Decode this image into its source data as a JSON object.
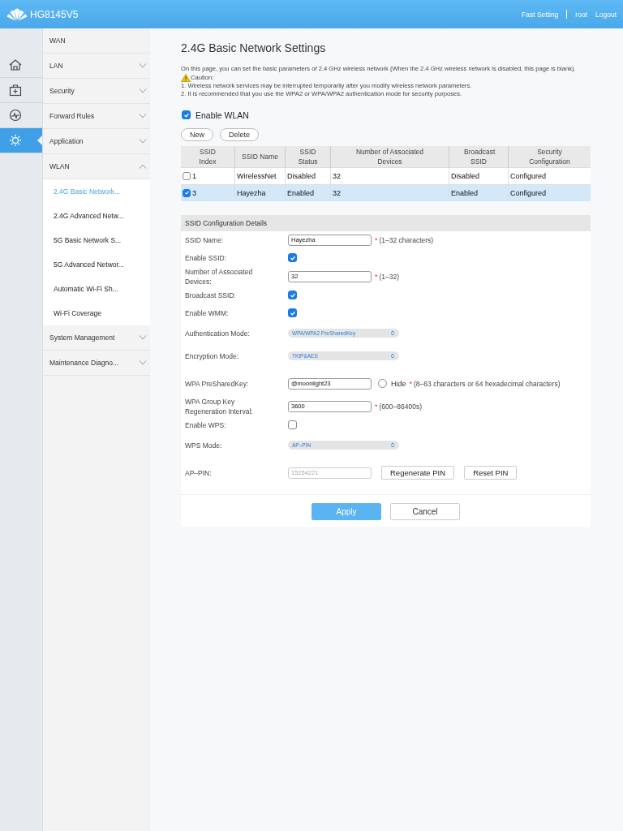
{
  "header": {
    "logo_text": "HG8145V5",
    "links": [
      "Fast Setting",
      "root",
      "Logout"
    ]
  },
  "rail": [
    {
      "selected": false
    },
    {
      "selected": false
    },
    {
      "selected": false
    },
    {
      "selected": true
    }
  ],
  "nav": [
    {
      "label": "WAN",
      "kind": "link"
    },
    {
      "label": "LAN",
      "kind": "group",
      "expanded": false
    },
    {
      "label": "Security",
      "kind": "group",
      "expanded": false
    },
    {
      "label": "Forward Rules",
      "kind": "group",
      "expanded": false
    },
    {
      "label": "Application",
      "kind": "group",
      "expanded": false
    },
    {
      "label": "WLAN",
      "kind": "group",
      "expanded": true,
      "children": [
        {
          "label": "2.4G Basic Network...",
          "selected": true
        },
        {
          "label": "2.4G Advanced Netw...",
          "selected": false
        },
        {
          "label": "5G Basic Network S...",
          "selected": false
        },
        {
          "label": "5G Advanced Networ...",
          "selected": false
        },
        {
          "label": "Automatic Wi-Fi Sh...",
          "selected": false
        },
        {
          "label": "Wi-Fi Coverage",
          "selected": false
        }
      ]
    },
    {
      "label": "System Management",
      "kind": "group",
      "expanded": false
    },
    {
      "label": "Maintenance Diagno...",
      "kind": "group",
      "expanded": false
    }
  ],
  "page": {
    "title": "2.4G Basic Network Settings",
    "intro": "On this page, you can set the basic parameters of 2.4 GHz wireless network (When the 2.4 GHz wireless network is disabled, this page is blank).",
    "caution_label": "Caution:",
    "notes": [
      "1. Wireless network services may be interrupted temporarily after you modify wireless network parameters.",
      "2. It is recommended that you use the WPA2 or WPA/WPA2 authentication mode for security purposes."
    ],
    "enable_wlan": {
      "label": "Enable WLAN",
      "checked": true
    },
    "buttons": [
      "New",
      "Delete"
    ],
    "table": {
      "columns": [
        "SSID Index",
        "SSID Name",
        "SSID Status",
        "Number of Associated Devices",
        "Broadcast SSID",
        "Security Configuration"
      ],
      "rows": [
        {
          "selected": false,
          "cells": [
            "1",
            "WirelessNet",
            "Disabled",
            "32",
            "Disabled",
            "Configured"
          ]
        },
        {
          "selected": true,
          "cells": [
            "3",
            "Hayezha",
            "Enabled",
            "32",
            "Enabled",
            "Configured"
          ]
        }
      ]
    },
    "details": {
      "heading": "SSID Configuration Details",
      "fields": [
        {
          "kind": "text",
          "label": "SSID Name:",
          "value": "Hayezha",
          "required_mark": "*",
          "hint": "(1–32 characters)"
        },
        {
          "kind": "checkbox",
          "label": "Enable SSID:",
          "checked": true
        },
        {
          "kind": "text",
          "label": "Number of Associated Devices:",
          "value": "32",
          "required_mark": "*",
          "hint": "(1–32)"
        },
        {
          "kind": "checkbox",
          "label": "Broadcast SSID:",
          "checked": true
        },
        {
          "kind": "checkbox",
          "label": "Enable WMM:",
          "checked": true
        },
        {
          "kind": "select",
          "label": "Authentication Mode:",
          "value": "WPA/WPA2 PreSharedKey"
        },
        {
          "kind": "select",
          "label": "Encryption Mode:",
          "value": "TKIP&AES"
        },
        {
          "kind": "key",
          "label": "WPA PreSharedKey:",
          "value": "@moonlight23",
          "hide_label": "Hide",
          "hide_checked": false,
          "required_mark": "*",
          "hint": "(8–63 characters or 64 hexadecimal characters)"
        },
        {
          "kind": "text",
          "label": "WPA Group Key Regeneration Interval:",
          "value": "3600",
          "required_mark": "*",
          "hint": "(600–86400s)"
        },
        {
          "kind": "checkbox",
          "label": "Enable WPS:",
          "checked": false
        },
        {
          "kind": "select",
          "label": "WPS Mode:",
          "value": "AP–PIN"
        },
        {
          "kind": "pin",
          "label": "AP–PIN:",
          "value": "15254221",
          "disabled": true,
          "buttons": [
            "Regenerate PIN",
            "Reset PIN"
          ]
        }
      ]
    },
    "actions": [
      {
        "label": "Apply",
        "kind": "primary"
      },
      {
        "label": "Cancel",
        "kind": "default"
      }
    ]
  }
}
